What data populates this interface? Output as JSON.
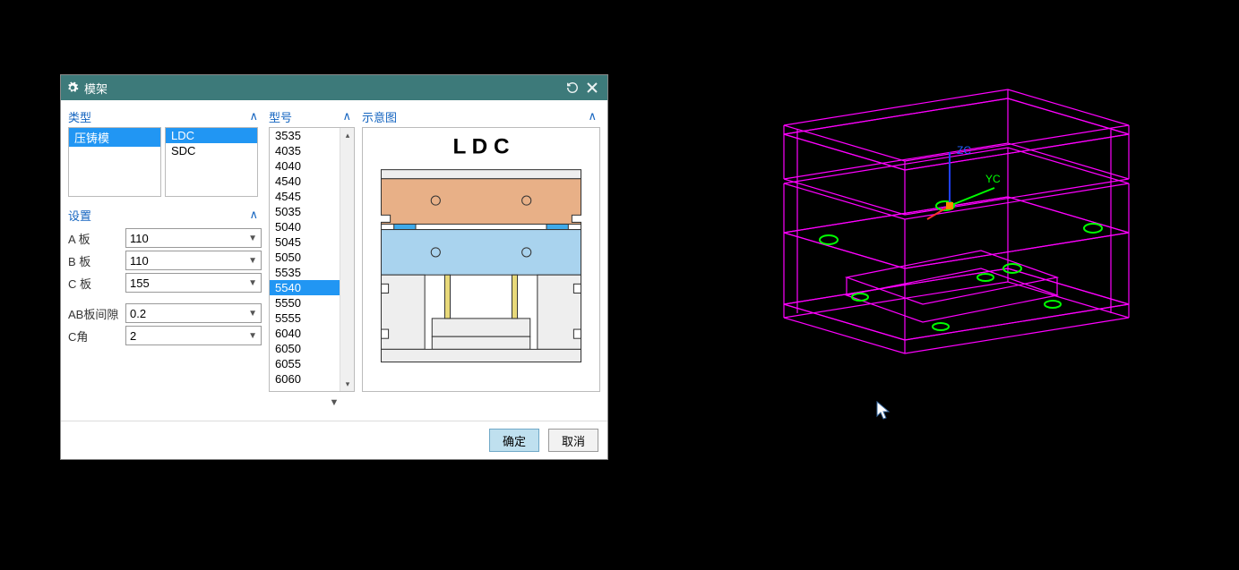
{
  "dialog": {
    "title": "模架",
    "sections": {
      "type_label": "类型",
      "model_label": "型号",
      "schematic_label": "示意图",
      "settings_label": "设置"
    },
    "type_list": {
      "items": [
        "压铸模"
      ],
      "selected": "压铸模"
    },
    "series_list": {
      "items": [
        "LDC",
        "SDC"
      ],
      "selected": "LDC"
    },
    "size_list": {
      "items": [
        "3535",
        "4035",
        "4040",
        "4540",
        "4545",
        "5035",
        "5040",
        "5045",
        "5050",
        "5535",
        "5540",
        "5550",
        "5555",
        "6040",
        "6050",
        "6055",
        "6060"
      ],
      "selected": "5540"
    },
    "settings": {
      "a_plate": {
        "label": "A 板",
        "value": "110"
      },
      "b_plate": {
        "label": "B 板",
        "value": "110"
      },
      "c_plate": {
        "label": "C 板",
        "value": "155"
      },
      "ab_gap": {
        "label": "AB板间隙",
        "value": "0.2"
      },
      "c_angle": {
        "label": "C角",
        "value": "2"
      }
    },
    "schematic_title": "L D C",
    "buttons": {
      "ok": "确定",
      "cancel": "取消"
    }
  },
  "viewport": {
    "axes": {
      "z": "ZC",
      "y": "YC"
    }
  }
}
